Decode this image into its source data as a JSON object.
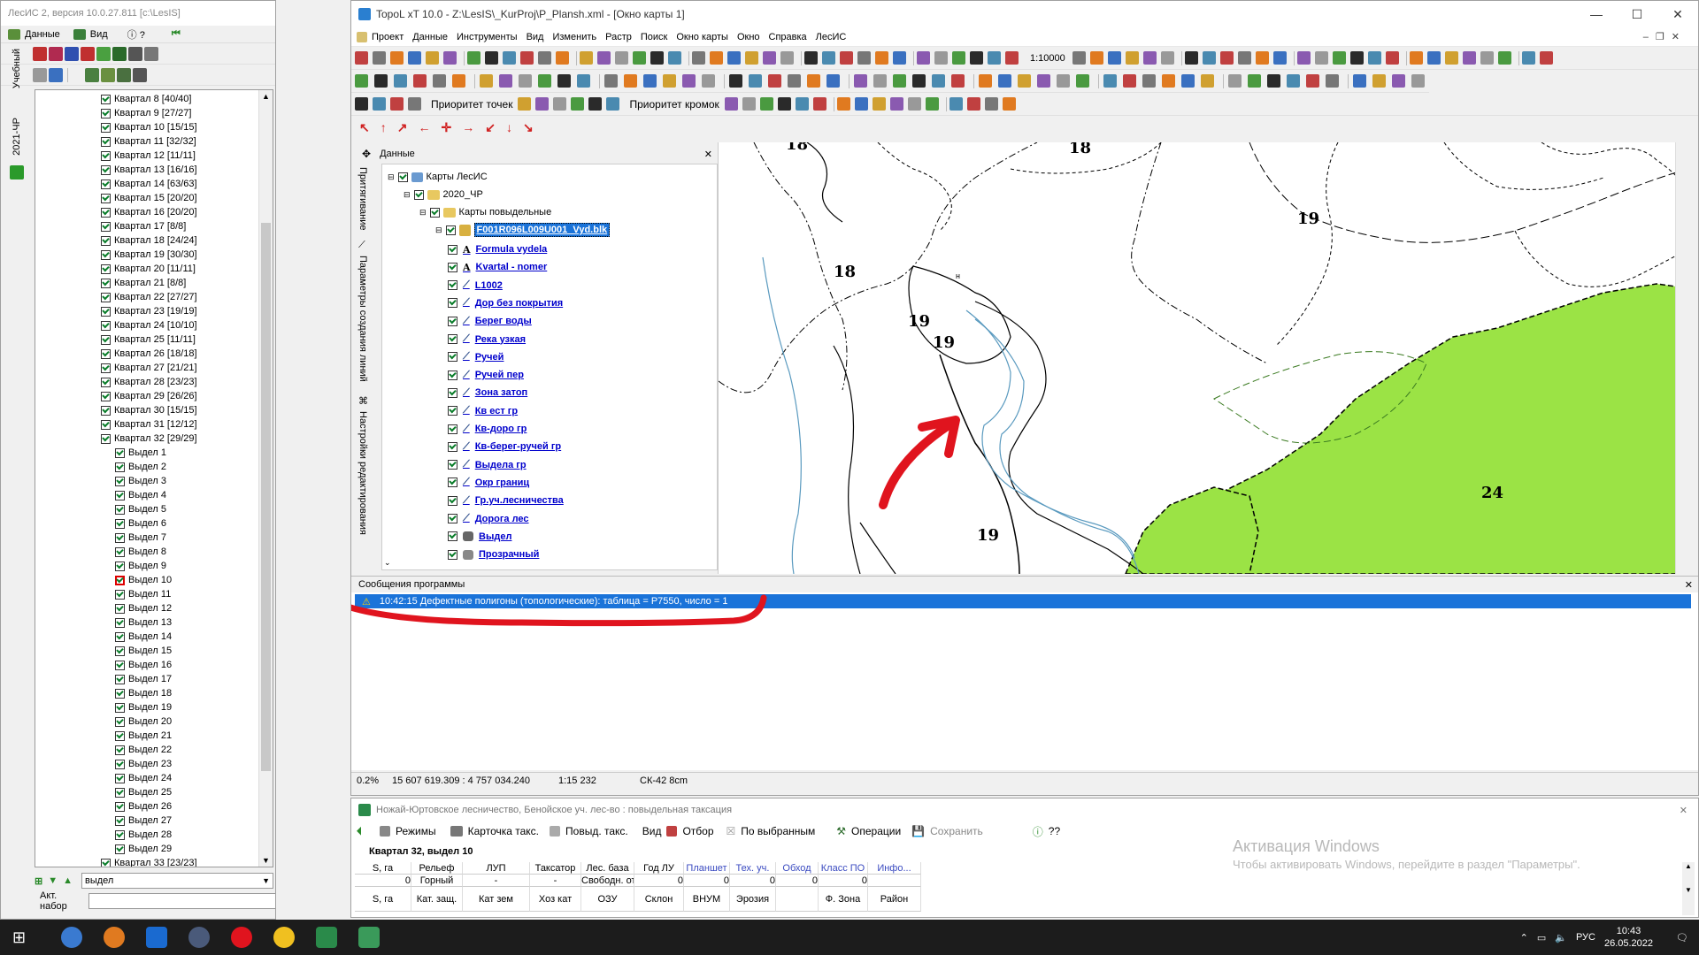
{
  "left_window": {
    "title": "ЛесИС 2, версия 10.0.27.811  [c:\\LesIS]",
    "menu": [
      "Данные",
      "Вид"
    ],
    "side_tabs": [
      "Учебный",
      "2021-ЧР"
    ],
    "tree": [
      "Квартал 8 [40/40]",
      "Квартал 9 [27/27]",
      "Квартал 10 [15/15]",
      "Квартал 11 [32/32]",
      "Квартал 12 [11/11]",
      "Квартал 13 [16/16]",
      "Квартал 14 [63/63]",
      "Квартал 15 [20/20]",
      "Квартал 16 [20/20]",
      "Квартал 17 [8/8]",
      "Квартал 18 [24/24]",
      "Квартал 19 [30/30]",
      "Квартал 20 [11/11]",
      "Квартал 21 [8/8]",
      "Квартал 22 [27/27]",
      "Квартал 23 [19/19]",
      "Квартал 24 [10/10]",
      "Квартал 25 [11/11]",
      "Квартал 26 [18/18]",
      "Квартал 27 [21/21]",
      "Квартал 28 [23/23]",
      "Квартал 29 [26/26]",
      "Квартал 30 [15/15]",
      "Квартал 31 [12/12]",
      "Квартал 32 [29/29]"
    ],
    "subtree": [
      "Выдел 1",
      "Выдел 2",
      "Выдел 3",
      "Выдел 4",
      "Выдел 5",
      "Выдел 6",
      "Выдел 7",
      "Выдел 8",
      "Выдел 9",
      "Выдел 10",
      "Выдел 11",
      "Выдел 12",
      "Выдел 13",
      "Выдел 14",
      "Выдел 15",
      "Выдел 16",
      "Выдел 17",
      "Выдел 18",
      "Выдел 19",
      "Выдел 20",
      "Выдел 21",
      "Выдел 22",
      "Выдел 23",
      "Выдел 24",
      "Выдел 25",
      "Выдел 26",
      "Выдел 27",
      "Выдел 28",
      "Выдел 29"
    ],
    "last_item": "Квартал 33 [23/23]",
    "filter_value": "выдел",
    "act_label": "Акт. набор"
  },
  "main_window": {
    "title": "TopoL xT 10.0 - Z:\\LesIS\\_KurProj\\P_Plansh.xml - [Окно карты 1]",
    "menu": [
      "Проект",
      "Данные",
      "Инструменты",
      "Вид",
      "Изменить",
      "Растр",
      "Поиск",
      "Окно карты",
      "Окно",
      "Справка",
      "ЛесИС"
    ],
    "scale": "1:10000",
    "priority_points": "Приоритет точек",
    "priority_edges": "Приоритет кромок",
    "side_tabs": [
      "Притягивание",
      "Параметры создания линий",
      "Настройки редактирования"
    ],
    "data_panel": {
      "title": "Данные",
      "root": "Карты ЛесИС",
      "n2020": "2020_ЧР",
      "maps": "Карты повыдельные",
      "file": "F001R096L009U001_Vyd.blk",
      "layers": [
        "Formula vydela",
        "Kvartal - nomer",
        "L1002",
        "Дор без покрытия",
        "Берег воды",
        "Река узкая",
        "Ручей",
        "Ручей пер",
        "Зона затоп",
        "Кв ест гр",
        "Кв-доро гр",
        "Кв-берег-ручей гр",
        "Выдела гр",
        "Окр границ",
        "Гр.уч.лесничества",
        "Дорога лес",
        "Выдел",
        "Прозрачный"
      ]
    },
    "map_labels": [
      "18",
      "18",
      "19",
      "18",
      "19",
      "19",
      "24",
      "19",
      "н"
    ],
    "messages": {
      "title": "Сообщения программы",
      "line": "10:42:15 Дефектные полигоны (топологические): таблица = P7550, число = 1"
    },
    "status": [
      "0.2%",
      "15 607 619.309 : 4 757 034.240",
      "1:15 232",
      "СК-42 8cm"
    ]
  },
  "bottom_window": {
    "title": "Ножай-Юртовское лесничество, Бенойское уч. лес-во : повыдельная таксация",
    "toolbar": [
      "Режимы",
      "Карточка такс.",
      "Повыд. такс.",
      "Вид",
      "Отбор",
      "По выбранным",
      "Операции",
      "Сохранить",
      "??"
    ],
    "section": "Квартал 32, выдел 10",
    "headers1": [
      "S, га",
      "Рельеф",
      "ЛУП",
      "Таксатор",
      "Лес. база",
      "Год ЛУ",
      "Планшет",
      "Тех. уч.",
      "Обход",
      "Класс ПО",
      "Инфо..."
    ],
    "values1": [
      "0",
      "Горный",
      "-",
      "-",
      "Свободн. от",
      "0",
      "0",
      "0",
      "0",
      "0",
      ""
    ],
    "headers2": [
      "S, га",
      "Кат. защ.",
      "Кат зем",
      "Хоз кат",
      "ОЗУ",
      "Склон",
      "ВНУМ",
      "Эрозия",
      "",
      "Ф. Зона",
      "Район"
    ]
  },
  "watermark": {
    "l1": "Активация Windows",
    "l2": "Чтобы активировать Windows, перейдите в раздел \"Параметры\"."
  },
  "taskbar": {
    "lang": "РУС",
    "time": "10:43",
    "date": "26.05.2022"
  },
  "colors": {
    "forest": "#9be345",
    "selection": "#1a73d9",
    "annotation": "#e0141e"
  }
}
